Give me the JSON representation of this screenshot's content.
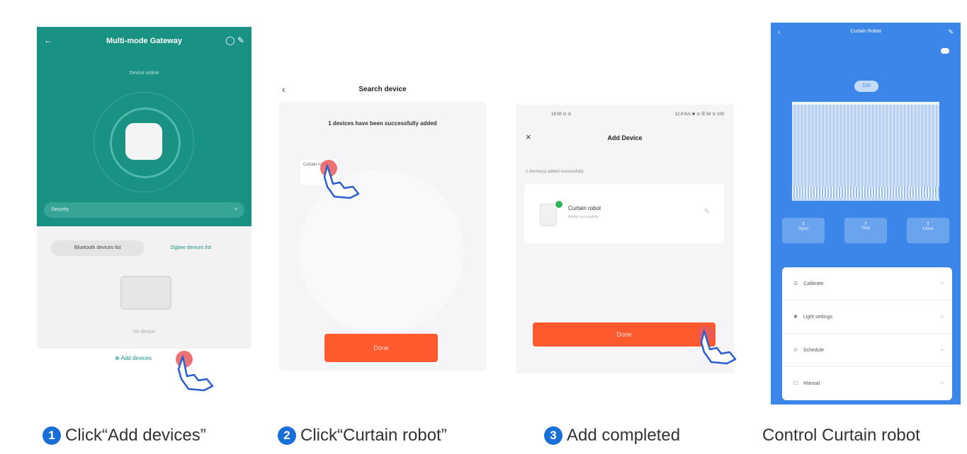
{
  "panel1": {
    "title": "Multi-mode Gateway",
    "back": "←",
    "header_icons": "◯ ✎",
    "subtitle": "Device online",
    "security_label": "Security",
    "security_chevron": ">",
    "tab_bluetooth": "Bluetooth devices list",
    "tab_zigbee": "Zigbee devices list",
    "no_device": "No device",
    "add_devices": "Add devices",
    "add_icon": "⊕"
  },
  "panel2": {
    "back": "‹",
    "title": "Search device",
    "message": "1 devices have been successfully added",
    "device_chip": "Curtain robot",
    "done": "Done"
  },
  "panel3": {
    "status_time": "18:50 ⊙ ⊙",
    "status_right": "12.9 K/s ✱ ⊙ ☰ 54 ≋ 100",
    "close": "×",
    "title": "Add Device",
    "label": "1 device(s) added successfully",
    "device_name": "Curtain robot",
    "device_sub": "Added successfully",
    "edit": "✎",
    "done": "Done"
  },
  "panel4": {
    "back": "‹",
    "title": "Curtain Robot",
    "edit": "✎",
    "percent": "100",
    "controls": [
      {
        "icon": "⫼",
        "label": "Open"
      },
      {
        "icon": "‖",
        "label": "Stop"
      },
      {
        "icon": "⫼",
        "label": "Close"
      }
    ],
    "rows": [
      {
        "icon": "☰",
        "label": "Calibrate",
        "chev": ">"
      },
      {
        "icon": "✱",
        "label": "Light settings",
        "chev": ">"
      },
      {
        "icon": "⊙",
        "label": "Schedule",
        "chev": ">"
      },
      {
        "icon": "☐",
        "label": "Manual",
        "chev": ">"
      }
    ]
  },
  "captions": [
    {
      "num": "1",
      "text": "Click“Add devices”"
    },
    {
      "num": "2",
      "text": "Click“Curtain robot”"
    },
    {
      "num": "3",
      "text": "Add completed"
    },
    {
      "num": "",
      "text": "Control Curtain robot"
    }
  ],
  "colors": {
    "teal": "#1a9283",
    "orange": "#ff5a2e",
    "blue": "#3b86e8",
    "step_badge": "#1a6fd6"
  }
}
